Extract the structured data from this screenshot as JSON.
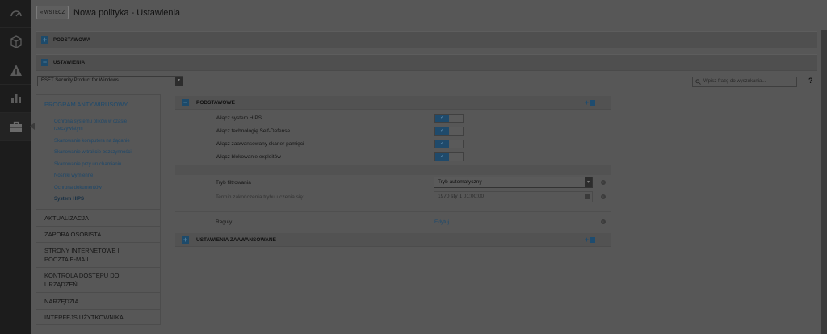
{
  "sidebar_rail": {
    "icons": [
      "dashboard-icon",
      "box-icon",
      "warning-icon",
      "chart-icon",
      "briefcase-icon"
    ]
  },
  "header": {
    "back_label": "« WSTECZ",
    "title": "Nowa polityka - Ustawienia"
  },
  "bars": {
    "basic_label": "PODSTAWOWA",
    "basic_toggle": "+",
    "settings_label": "USTAWIENIA",
    "settings_toggle": "−"
  },
  "product_select": {
    "value": "ESET Security Product for Windows",
    "arrow": "▾"
  },
  "search": {
    "placeholder": "Wpisz frazę do wyszukania..."
  },
  "help": "?",
  "nav": {
    "section_title": "PROGRAM ANTYWIRUSOWY",
    "sub_items": [
      {
        "label": "Ochrona systemu plików w czasie rzeczywistym"
      },
      {
        "label": "Skanowanie komputera na żądanie"
      },
      {
        "label": "Skanowanie w trakcie bezczynności"
      },
      {
        "label": "Skanowanie przy uruchamianiu"
      },
      {
        "label": "Nośniki wymienne"
      },
      {
        "label": "Ochrona dokumentów"
      },
      {
        "label": "System HIPS"
      }
    ],
    "items": [
      {
        "label": "AKTUALIZACJA"
      },
      {
        "label": "ZAPORA OSOBISTA"
      },
      {
        "label": "STRONY INTERNETOWE I POCZTA E-MAIL"
      },
      {
        "label": "KONTROLA DOSTĘPU DO URZĄDZEŃ"
      },
      {
        "label": "NARZĘDZIA"
      },
      {
        "label": "INTERFEJS UŻYTKOWNIKA"
      }
    ]
  },
  "content": {
    "basic_section": {
      "label": "PODSTAWOWE",
      "toggle": "−",
      "add": "+"
    },
    "toggles": [
      {
        "label": "Włącz system HIPS",
        "check": "✓"
      },
      {
        "label": "Włącz technologię Self-Defense",
        "check": "✓"
      },
      {
        "label": "Włącz zaawansowany skaner pamięci",
        "check": "✓"
      },
      {
        "label": "Włącz blokowanie exploitów",
        "check": "✓"
      }
    ],
    "filter_mode": {
      "label": "Tryb filtrowania",
      "value": "Tryb automatyczny",
      "arrow": "▾"
    },
    "learning_end": {
      "label": "Termin zakończenia trybu uczenia się:",
      "value": "1970 sty 1 01:00:00"
    },
    "rules": {
      "label": "Reguły",
      "link": "Edytuj"
    },
    "info_glyph": "i",
    "advanced_section": {
      "label": "USTAWIENIA ZAAWANSOWANE",
      "toggle": "+",
      "add": "+"
    }
  }
}
